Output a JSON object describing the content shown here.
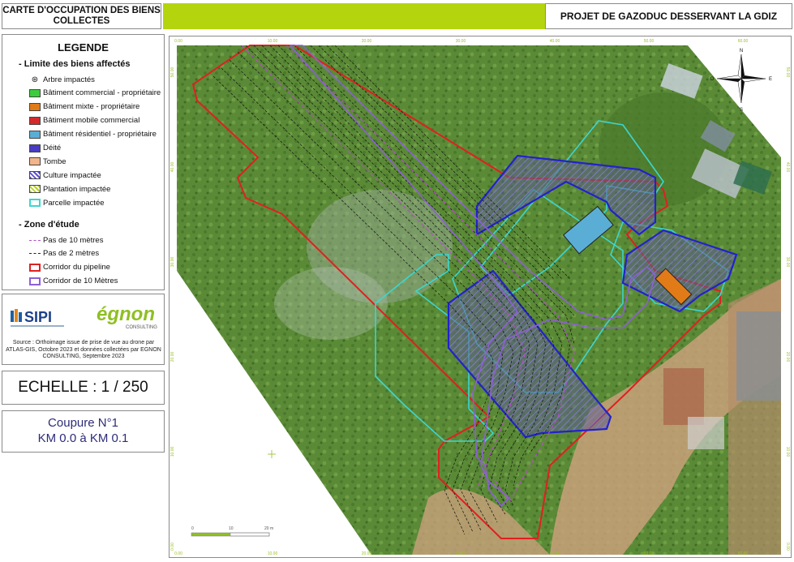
{
  "header": {
    "left_title": "CARTE D'OCCUPATION DES BIENS COLLECTES",
    "right_title": "PROJET DE GAZODUC DESSERVANT LA GDIZ"
  },
  "legend": {
    "title": "LEGENDE",
    "section1": "- Limite des biens affectés",
    "items": [
      {
        "label": "Arbre impactés",
        "kind": "symbol",
        "color": "#333333"
      },
      {
        "label": "Bâtiment commercial - propriétaire",
        "kind": "fill",
        "color": "#3dcc3d"
      },
      {
        "label": "Bâtiment mixte - propriétaire",
        "kind": "fill",
        "color": "#e07b18"
      },
      {
        "label": "Bâtiment mobile commercial",
        "kind": "fill",
        "color": "#d62a2a"
      },
      {
        "label": "Bâtiment résidentiel - propriétaire",
        "kind": "fill",
        "color": "#5aaed6"
      },
      {
        "label": "Déité",
        "kind": "fill",
        "color": "#4a3bc4"
      },
      {
        "label": "Tombe",
        "kind": "fill",
        "color": "#f2b48a"
      },
      {
        "label": "Culture impactée",
        "kind": "hatch",
        "color": "#5b4fd4"
      },
      {
        "label": "Plantation impactée",
        "kind": "hatch",
        "color": "#b9d02a"
      },
      {
        "label": "Parcelle impactée",
        "kind": "outline",
        "color": "#3cd6d0"
      }
    ],
    "section2": "- Zone d'étude",
    "zone_items": [
      {
        "label": "Pas de 10 mètres",
        "kind": "dash",
        "color": "#b34fc8"
      },
      {
        "label": "Pas de 2 mètres",
        "kind": "dash",
        "color": "#222222"
      },
      {
        "label": "Corridor du pipeline",
        "kind": "outline",
        "color": "#e02020"
      },
      {
        "label": "Corridor de 10 Mètres",
        "kind": "outline",
        "color": "#8e5fd6"
      }
    ]
  },
  "logos": {
    "sipi": "SIPI",
    "egnon": "égnon",
    "egnon_sub": "CONSULTING",
    "source": "Source : Orthoimage issue de prise de vue au drone par ATLAS-GIS,  Octobre 2023 et données collectées par EGNON CONSULTING, Septembre 2023"
  },
  "scale": {
    "label": "ECHELLE : 1 / 250"
  },
  "coupure": {
    "line1": "Coupure N°1",
    "line2": "KM 0.0  à KM 0.1"
  },
  "map": {
    "x_ticks": [
      "0.00",
      "10.00",
      "20.00",
      "30.00",
      "40.00",
      "50.00",
      "60.00"
    ],
    "y_ticks": [
      "0.00",
      "10.00",
      "20.00",
      "30.00",
      "40.00",
      "50.00"
    ],
    "scalebar": [
      "0",
      "10",
      "20 m"
    ],
    "compass": {
      "n": "N",
      "s": "S",
      "e": "E",
      "o": "O"
    },
    "colors": {
      "accent": "#b4d40e",
      "vegetation": "#5b8a37",
      "pipeline_corridor": "#e02020",
      "culture": "#2a2ad0",
      "parcelle": "#3cd6d0"
    }
  }
}
